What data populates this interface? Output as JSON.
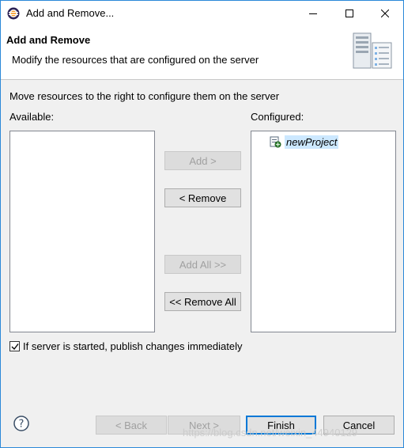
{
  "window": {
    "title": "Add and Remove...",
    "accent_color": "#2b88d8"
  },
  "header": {
    "title": "Add and Remove",
    "description": "Modify the resources that are configured on the server",
    "icon": "server-icon"
  },
  "main": {
    "instruction": "Move resources to the right to configure them on the server",
    "available_label": "Available:",
    "configured_label": "Configured:",
    "available_items": [],
    "configured_items": [
      {
        "label": "newProject",
        "icon": "web-project-icon",
        "selected": true
      }
    ]
  },
  "buttons": {
    "add": "Add >",
    "remove": "< Remove",
    "add_all": "Add All >>",
    "remove_all": "<< Remove All"
  },
  "checkbox": {
    "label": "If server is started, publish changes immediately",
    "checked": true
  },
  "footer": {
    "back": "< Back",
    "next": "Next >",
    "finish": "Finish",
    "cancel": "Cancel",
    "help_icon": "help-icon"
  },
  "watermark": "https://blog.csdn.net/weixin_44940129"
}
